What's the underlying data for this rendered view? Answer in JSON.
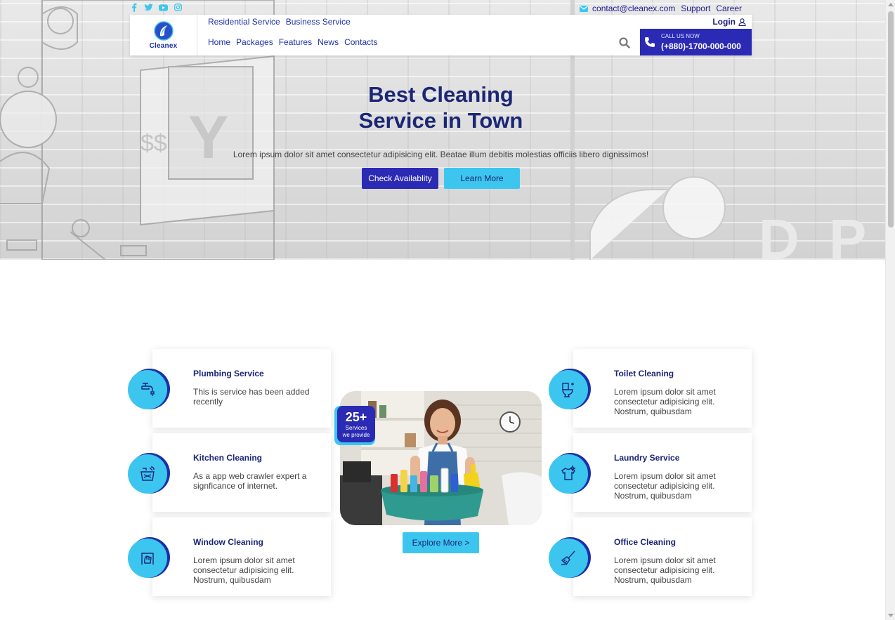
{
  "social": [
    {
      "icon": "facebook-icon"
    },
    {
      "icon": "twitter-icon"
    },
    {
      "icon": "youtube-icon"
    },
    {
      "icon": "instagram-icon"
    }
  ],
  "topbar": {
    "email": "contact@cleanex.com",
    "support": "Support",
    "career": "Career"
  },
  "brand": {
    "name": "Cleanex"
  },
  "nav": {
    "secondary": [
      "Residential Service",
      "Business Service"
    ],
    "main": [
      "Home",
      "Packages",
      "Features",
      "News",
      "Contacts"
    ],
    "login": "Login"
  },
  "call": {
    "label": "CALL US NOW",
    "number": "(+880)-1700-000-000"
  },
  "hero": {
    "title_line1": "Best Cleaning",
    "title_line2": "Service in Town",
    "subtitle": "Lorem ipsum dolor sit amet consectetur adipisicing elit. Beatae illum debitis molestias officiis libero dignissimos!",
    "btn_primary": "Check Availablity",
    "btn_secondary": "Learn More"
  },
  "services_left": [
    {
      "title": "Plumbing Service",
      "desc": "This is service has been added recently",
      "icon": "faucet-icon"
    },
    {
      "title": "Kitchen Cleaning",
      "desc": "As a app web crawler expert a signficance of internet.",
      "icon": "kitchen-sink-icon"
    },
    {
      "title": "Window Cleaning",
      "desc": "Lorem ipsum dolor sit amet consectetur adipisicing elit. Nostrum, quibusdam",
      "icon": "window-wipe-icon"
    }
  ],
  "services_right": [
    {
      "title": "Toilet Cleaning",
      "desc": "Lorem ipsum dolor sit amet consectetur adipisicing elit. Nostrum, quibusdam",
      "icon": "toilet-icon"
    },
    {
      "title": "Laundry Service",
      "desc": "Lorem ipsum dolor sit amet consectetur adipisicing elit. Nostrum, quibusdam",
      "icon": "shirt-icon"
    },
    {
      "title": "Office Cleaning",
      "desc": "Lorem ipsum dolor sit amet consectetur adipisicing elit. Nostrum, quibusdam",
      "icon": "broom-icon"
    }
  ],
  "badge": {
    "number": "25+",
    "line1": "Services",
    "line2": "we provide"
  },
  "explore": "Explore More >",
  "colors": {
    "primary": "#2a2ab5",
    "accent": "#3cc6ef",
    "heading": "#1b2675"
  }
}
